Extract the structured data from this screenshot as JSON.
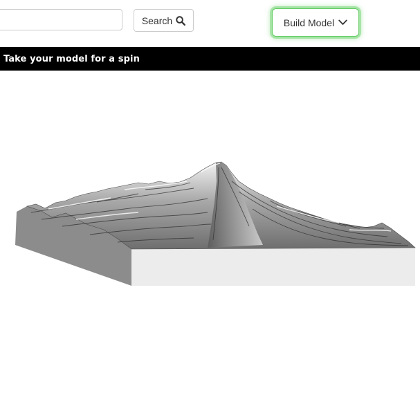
{
  "toolbar": {
    "search_input_value": "",
    "search_placeholder": "",
    "search_label": "Search",
    "search_icon": "magnifier-icon",
    "build_label": "Build Model",
    "build_icon": "chevron-down-icon",
    "build_focus_color": "#8fd88f"
  },
  "banner": {
    "text": "Take your model for a spin",
    "background": "#000000",
    "color": "#ffffff"
  },
  "viewer": {
    "model": "3d-terrain-model",
    "left_face_color": "#8c8c8c",
    "front_face_color": "#ececec",
    "surface_color": "#bdbdbd"
  }
}
